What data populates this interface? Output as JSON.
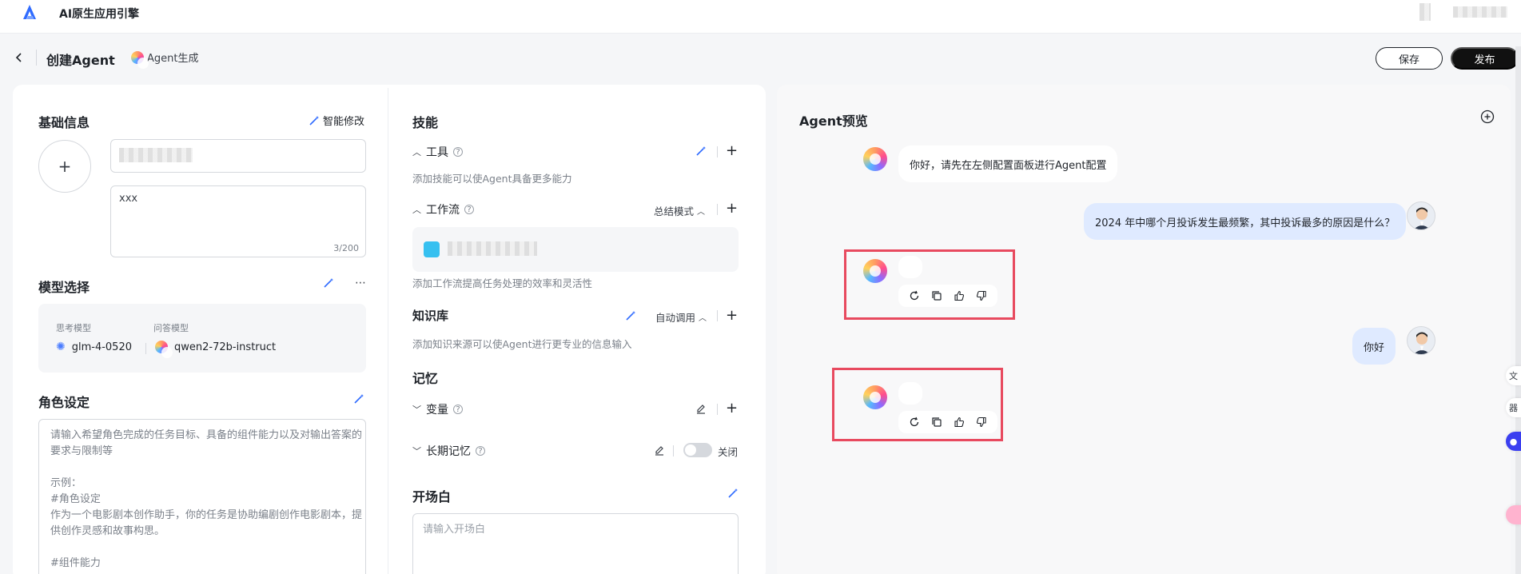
{
  "app": {
    "title": "AI原生应用引擎"
  },
  "header": {
    "title": "创建Agent",
    "gen_tag": "Agent生成",
    "save_label": "保存",
    "publish_label": "发布"
  },
  "basic": {
    "title": "基础信息",
    "smart_edit": "智能修改",
    "description": "xxx",
    "description_count": "3/200"
  },
  "model": {
    "title": "模型选择",
    "think_label": "思考模型",
    "think_value": "glm-4-0520",
    "answer_label": "问答模型",
    "answer_value": "qwen2-72b-instruct"
  },
  "role": {
    "title": "角色设定",
    "placeholder_lines": [
      "请输入希望角色完成的任务目标、具备的组件能力以及对输出答案的",
      "要求与限制等",
      "",
      "示例：",
      "#角色设定",
      "作为一个电影剧本创作助手，你的任务是协助编剧创作电影剧本，提",
      "供创作灵感和故事构思。",
      "",
      "#组件能力"
    ]
  },
  "skills": {
    "title": "技能",
    "tools_label": "工具",
    "tools_hint": "添加技能可以使Agent具备更多能力",
    "workflow_label": "工作流",
    "workflow_mode": "总结模式",
    "workflow_hint": "添加工作流提高任务处理的效率和灵活性",
    "kb_label": "知识库",
    "kb_mode": "自动调用",
    "kb_hint": "添加知识来源可以使Agent进行更专业的信息输入"
  },
  "memory": {
    "title": "记忆",
    "variables_label": "变量",
    "long_term_label": "长期记忆",
    "long_term_state": "关闭",
    "long_term_on": false
  },
  "opener": {
    "title": "开场白",
    "placeholder": "请输入开场白"
  },
  "preview": {
    "title": "Agent预览",
    "messages": [
      {
        "role": "bot",
        "text": "你好，请先在左侧配置面板进行Agent配置"
      },
      {
        "role": "user",
        "text": "2024 年中哪个月投诉发生最频繁，其中投诉最多的原因是什么？"
      },
      {
        "role": "bot",
        "text": ""
      },
      {
        "role": "user",
        "text": "你好"
      },
      {
        "role": "bot",
        "text": ""
      }
    ]
  },
  "side_icons": [
    "文",
    "器"
  ]
}
